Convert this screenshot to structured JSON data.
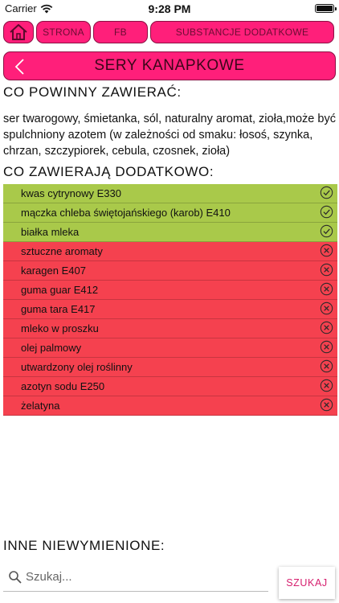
{
  "status_bar": {
    "carrier": "Carrier",
    "time": "9:28 PM"
  },
  "nav": {
    "tabs": [
      {
        "label": "STRONA"
      },
      {
        "label": "FB"
      },
      {
        "label": "SUBSTANCJE DODATKOWE"
      }
    ]
  },
  "header": {
    "title": "SERY KANAPKOWE"
  },
  "content": {
    "should_contain_heading": "CO POWINNY ZAWIERAĆ:",
    "should_contain_text": "ser twarogowy, śmietanka, sól, naturalny aromat, zioła,może być spulchniony azotem (w zależności od smaku: łosoś, szynka, chrzan, szczypiorek, cebula, czosnek, zioła)",
    "additional_heading": "CO ZAWIERAJĄ DODATKOWO:",
    "ingredients": [
      {
        "name": "kwas cytrynowy E330",
        "status": "ok"
      },
      {
        "name": "mączka chleba świętojańskiego (karob) E410",
        "status": "ok"
      },
      {
        "name": "białka mleka",
        "status": "ok"
      },
      {
        "name": "sztuczne aromaty",
        "status": "bad"
      },
      {
        "name": "karagen E407",
        "status": "bad"
      },
      {
        "name": "guma guar E412",
        "status": "bad"
      },
      {
        "name": "guma tara E417",
        "status": "bad"
      },
      {
        "name": "mleko w proszku",
        "status": "bad"
      },
      {
        "name": "olej palmowy",
        "status": "bad"
      },
      {
        "name": "utwardzony olej roślinny",
        "status": "bad"
      },
      {
        "name": "azotyn sodu E250",
        "status": "bad"
      },
      {
        "name": "żelatyna",
        "status": "bad"
      }
    ],
    "other_heading": "INNE NIEWYMIENIONE:"
  },
  "search": {
    "placeholder": "Szukaj...",
    "value": "",
    "button_label": "SZUKAJ"
  },
  "colors": {
    "accent": "#ff1f7a",
    "ok": "#a9c94a",
    "bad": "#f5414f",
    "button_text": "#d6206f"
  },
  "icons": {
    "ok": "check-circle-icon",
    "bad": "x-circle-icon"
  }
}
